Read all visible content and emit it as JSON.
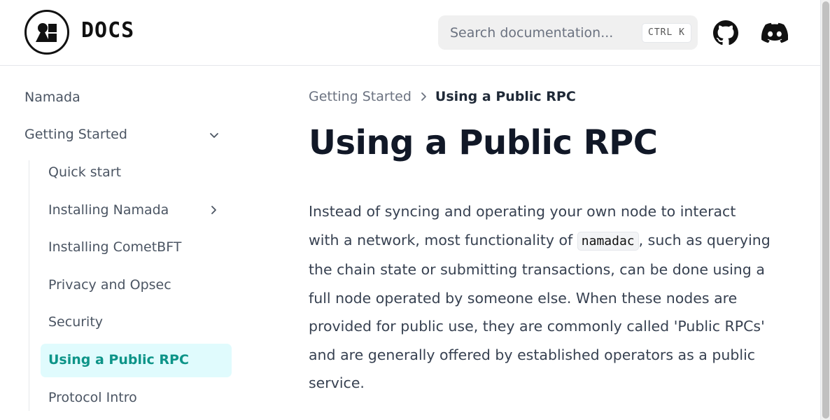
{
  "header": {
    "logo_text": "DOCS",
    "search_placeholder": "Search documentation...",
    "search_shortcut": "CTRL K"
  },
  "sidebar": {
    "items": [
      {
        "label": "Namada"
      },
      {
        "label": "Getting Started",
        "expanded": true
      },
      {
        "label": "Quick start"
      },
      {
        "label": "Installing Namada",
        "has_children": true
      },
      {
        "label": "Installing CometBFT"
      },
      {
        "label": "Privacy and Opsec"
      },
      {
        "label": "Security"
      },
      {
        "label": "Using a Public RPC",
        "active": true
      },
      {
        "label": "Protocol Intro"
      }
    ]
  },
  "breadcrumb": {
    "parent": "Getting Started",
    "current": "Using a Public RPC"
  },
  "main": {
    "title": "Using a Public RPC",
    "para_part1": "Instead of syncing and operating your own node to interact with a network, most functionality of ",
    "para_code": "namadac",
    "para_part2": ", such as querying the chain state or submitting transactions, can be done using a full node operated by someone else. When these nodes are provided for public use, they are commonly called 'Public RPCs' and are generally offered by established operators as a public service."
  },
  "colors": {
    "accent": "#0d9488",
    "active_bg": "#e0fbfd",
    "title": "#111827"
  }
}
